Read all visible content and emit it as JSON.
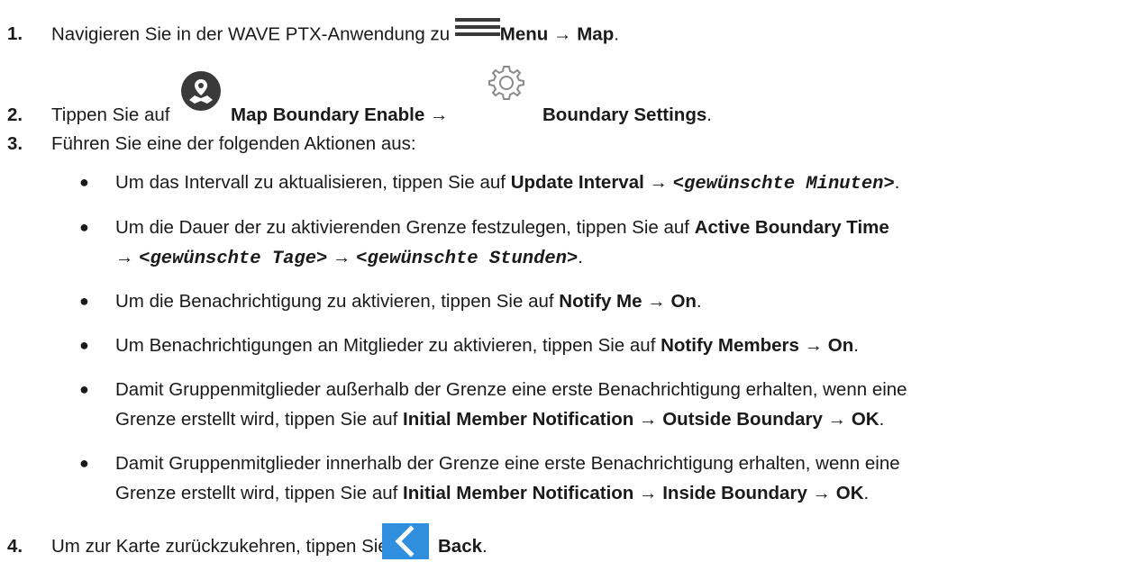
{
  "steps": [
    {
      "number": "1.",
      "prefix": "Navigieren Sie in der WAVE PTX-Anwendung zu ",
      "icon": "hamburger-menu-icon",
      "b1": "Menu",
      "arrow1": " → ",
      "b2": "Map",
      "suffix": "."
    },
    {
      "number": "2.",
      "prefix": "Tippen Sie auf ",
      "icon1": "map-boundary-icon",
      "b1": "Map Boundary Enable",
      "arrow1": " → ",
      "icon2": "gear-icon",
      "b2": "Boundary Settings",
      "suffix": "."
    },
    {
      "number": "3.",
      "text": "Führen Sie eine der folgenden Aktionen aus:",
      "bullets": [
        {
          "prefix": "Um das Intervall zu aktualisieren, tippen Sie auf ",
          "b1": "Update Interval",
          "arrow1": " → ",
          "m1": "<gewünschte Minuten>",
          "suffix": "."
        },
        {
          "prefix": "Um die Dauer der zu aktivierenden Grenze festzulegen, tippen Sie auf ",
          "b1": "Active Boundary Time",
          "arrow0": "→ ",
          "m1": "<gewünschte Tage>",
          "arrow1": " → ",
          "m2": "<gewünschte Stunden>",
          "suffix": "."
        },
        {
          "prefix": "Um die Benachrichtigung zu aktivieren, tippen Sie auf ",
          "b1": "Notify Me",
          "arrow1": " → ",
          "b2": "On",
          "suffix": "."
        },
        {
          "prefix": "Um Benachrichtigungen an Mitglieder zu aktivieren, tippen Sie auf ",
          "b1": "Notify Members",
          "arrow1": " → ",
          "b2": "On",
          "suffix": "."
        },
        {
          "line1": "Damit Gruppenmitglieder außerhalb der Grenze eine erste Benachrichtigung erhalten, wenn eine",
          "prefix": "Grenze erstellt wird, tippen Sie auf ",
          "b1": "Initial Member Notification",
          "arrow1": " → ",
          "b2": "Outside Boundary",
          "arrow2": " → ",
          "b3": "OK",
          "suffix": "."
        },
        {
          "line1": "Damit Gruppenmitglieder innerhalb der Grenze eine erste Benachrichtigung erhalten, wenn eine",
          "prefix": "Grenze erstellt wird, tippen Sie auf ",
          "b1": "Initial Member Notification",
          "arrow1": " → ",
          "b2": "Inside Boundary",
          "arrow2": " → ",
          "b3": "OK",
          "suffix": "."
        }
      ]
    },
    {
      "number": "4.",
      "prefix": "Um zur Karte zurückzukehren, tippen Sie auf ",
      "icon": "back-icon",
      "b1": "Back",
      "suffix": "."
    }
  ],
  "colors": {
    "text": "#1a1a1a",
    "back_button": "#2f8fde",
    "icon_dark": "#3a3a3a",
    "gear_outline": "#8a8a8a"
  }
}
